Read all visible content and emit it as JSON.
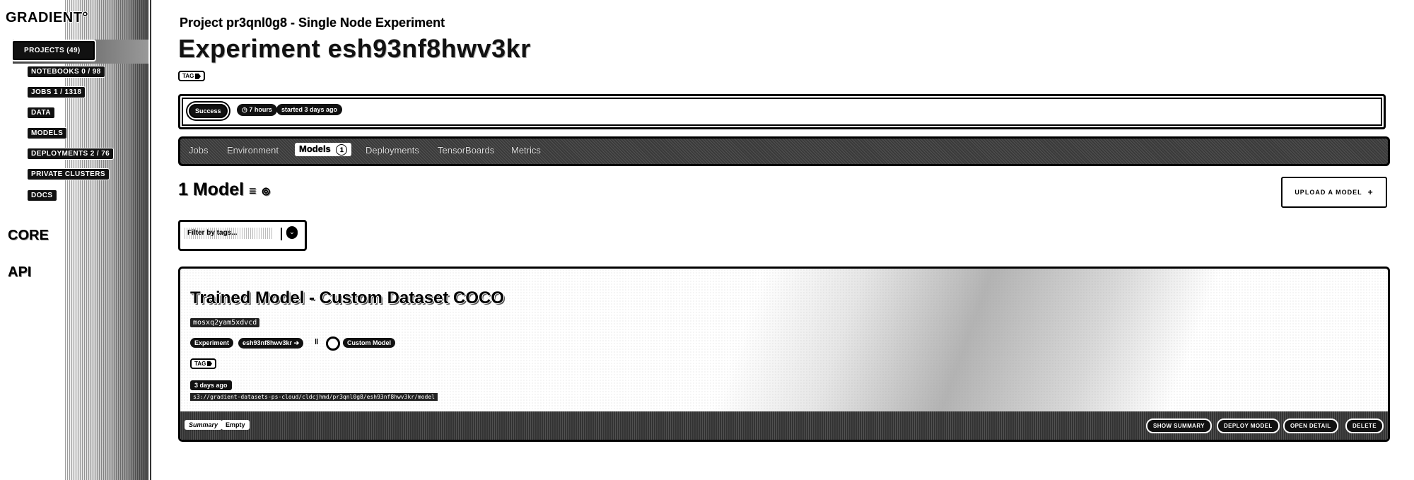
{
  "sidebar": {
    "brand": "GRADIENT°",
    "items": [
      {
        "label": "PROJECTS (49)",
        "active": true
      },
      {
        "label": "NOTEBOOKS 0 / 98"
      },
      {
        "label": "JOBS 1 / 1318"
      },
      {
        "label": "DATA"
      },
      {
        "label": "MODELS"
      },
      {
        "label": "DEPLOYMENTS 2 / 76"
      },
      {
        "label": "PRIVATE CLUSTERS"
      },
      {
        "label": "DOCS"
      }
    ],
    "sections": [
      "CORE",
      "API"
    ]
  },
  "header": {
    "project_title": "Project pr3qnl0g8 - Single Node Experiment",
    "experiment_title": "Experiment esh93nf8hwv3kr",
    "tag_label": "TAG"
  },
  "status": {
    "state": "Success",
    "duration": "7 hours",
    "started": "started 3 days ago"
  },
  "tabs": [
    {
      "label": "Jobs"
    },
    {
      "label": "Environment"
    },
    {
      "label": "Models",
      "count": "1",
      "active": true
    },
    {
      "label": "Deployments"
    },
    {
      "label": "TensorBoards"
    },
    {
      "label": "Metrics"
    }
  ],
  "models_section": {
    "heading": "1 Model",
    "upload_label": "UPLOAD A MODEL",
    "upload_icon": "+",
    "filter_placeholder": "Filter by tags..."
  },
  "model_card": {
    "name": "Trained Model - Custom Dataset COCO",
    "id": "mosxq2yam5xdvcd",
    "experiment_label": "Experiment",
    "experiment_id": "esh93nf8hwv3kr",
    "type": "Custom Model",
    "tag_label": "TAG",
    "age": "3 days ago",
    "path": "s3://gradient-datasets-ps-cloud/cldcjhmd/pr3qnl0g8/esh93nf8hwv3kr/model",
    "footer_tabs": [
      "Summary",
      "Empty"
    ],
    "actions": [
      "SHOW SUMMARY",
      "DEPLOY MODEL",
      "OPEN DETAIL",
      "DELETE"
    ]
  }
}
